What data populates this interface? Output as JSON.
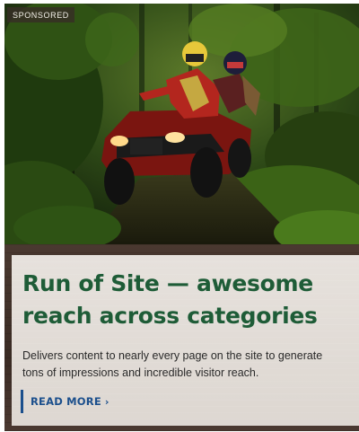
{
  "ad": {
    "badge": "SPONSORED",
    "image_alt": "ATV riders on a forest trail"
  },
  "article": {
    "headline": "Run of Site — awesome reach across categories",
    "description": "Delivers content to nearly every page on the site to generate tons of impressions and incredible visitor reach.",
    "cta_label": "READ MORE",
    "cta_icon": "chevron-right-icon"
  },
  "colors": {
    "headline": "#1e5c37",
    "cta": "#1b4f8c",
    "band": "#3b2d27",
    "panel": "#e3ded9"
  }
}
